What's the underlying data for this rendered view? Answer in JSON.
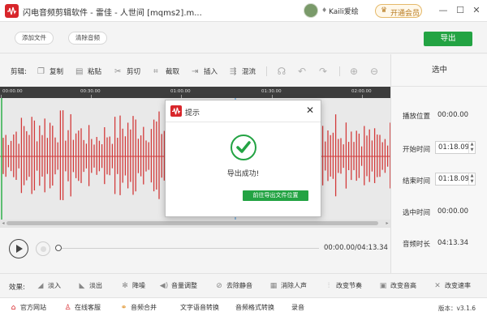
{
  "app": {
    "title": "闪电音频剪辑软件 - 雷佳 - 人世间 [mqms2].m...",
    "user_name": "Kaili爱绘",
    "vip_mark": "♦",
    "vip_button": "开通会员",
    "window_controls": [
      "minimize-icon",
      "maximize-icon",
      "close-icon"
    ]
  },
  "top": {
    "add_file": "添加文件",
    "clear_audio": "清除音频",
    "export": "导出"
  },
  "toolbar": {
    "label": "剪辑:",
    "copy": "复制",
    "paste": "粘贴",
    "cut": "剪切",
    "crop": "截取",
    "insert": "插入",
    "mix": "混流"
  },
  "timeline": {
    "ticks": [
      "00:00.00",
      "00:30.00",
      "01:00.00",
      "01:30.00",
      "02:00.00"
    ]
  },
  "panel": {
    "title": "选中",
    "play_position_label": "播放位置",
    "play_position_value": "00:00.00",
    "start_time_label": "开始时间",
    "start_time_value": "01:18.09",
    "end_time_label": "结束时间",
    "end_time_value": "01:18.09",
    "selection_time_label": "选中时间",
    "selection_time_value": "00:00.00",
    "duration_label": "音频时长",
    "duration_value": "04:13.34"
  },
  "player": {
    "time_readout": "00:00.00/04:13.34",
    "progress": 0
  },
  "effects": {
    "label": "效果:",
    "items": [
      "淡入",
      "淡出",
      "降噪",
      "音量调整",
      "去除静音",
      "消除人声",
      "改变节奏",
      "改变音高",
      "改变速率"
    ]
  },
  "footer": {
    "website": "官方网站",
    "support": "在线客服",
    "audio_merge": "音频合并",
    "tts": "文字语音转换",
    "format_convert": "音频格式转换",
    "record": "录音",
    "version": "版本：v3.1.6"
  },
  "dialog": {
    "title": "提示",
    "message": "导出成功!",
    "open_location": "前往导出文件位置"
  },
  "colors": {
    "accent_green": "#23a343",
    "brand_red": "#d8262b",
    "waveform": "#d33a3a",
    "timeline_bg": "#3d3d3d"
  }
}
